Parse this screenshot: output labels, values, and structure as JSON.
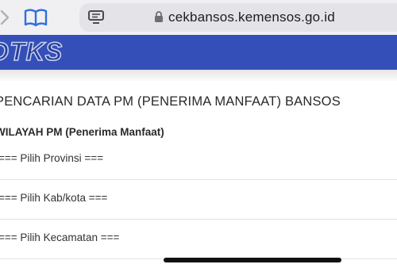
{
  "browser": {
    "url": "cekbansos.kemensos.go.id",
    "icons": [
      "forward-icon",
      "bookmarks-icon",
      "reader-mode-icon",
      "lock-icon"
    ]
  },
  "site": {
    "logo_text": "DTKS",
    "header_color": "#3450b8"
  },
  "main": {
    "title": "PENCARIAN DATA PM (PENERIMA MANFAAT) BANSOS",
    "section_label": "WILAYAH PM (Penerima Manfaat)",
    "selects": [
      {
        "selected": "=== Pilih Provinsi ==="
      },
      {
        "selected": "=== Pilih Kab/kota ==="
      },
      {
        "selected": "=== Pilih Kecamatan ==="
      }
    ]
  }
}
